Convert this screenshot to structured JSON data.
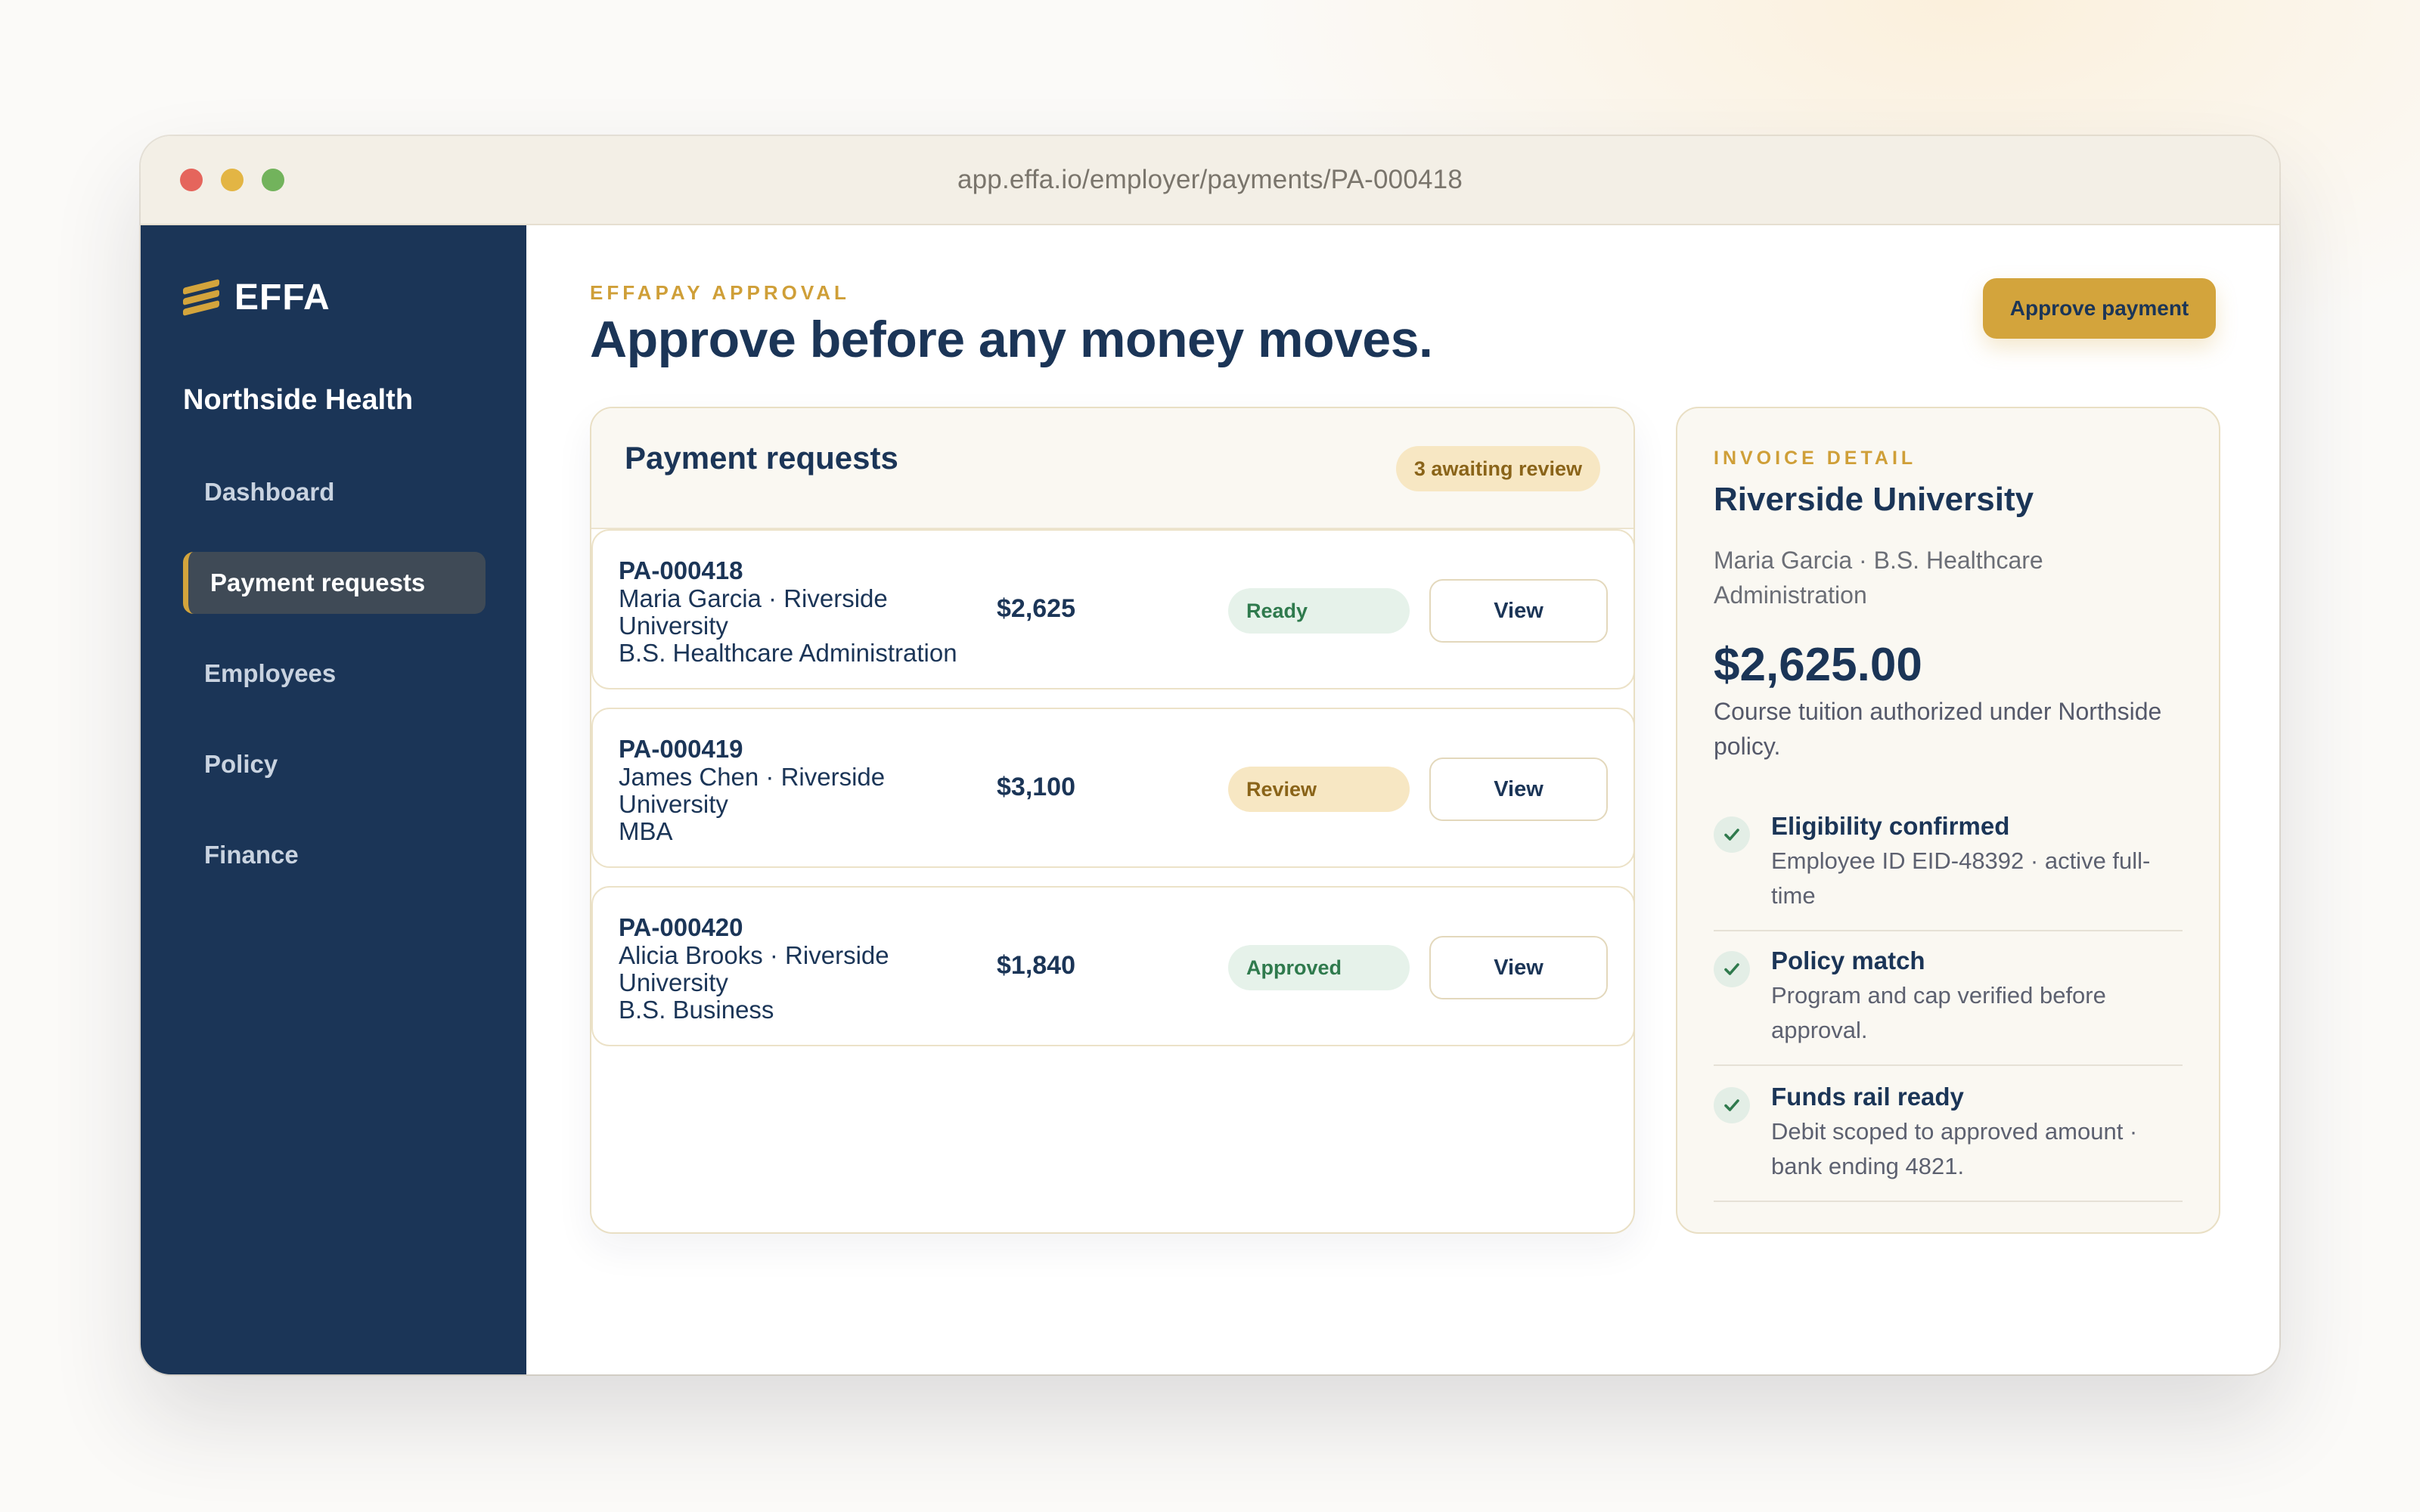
{
  "browser": {
    "url": "app.effa.io/employer/payments/PA-000418"
  },
  "sidebar": {
    "logo_text": "EFFA",
    "org_name": "Northside Health",
    "items": [
      {
        "label": "Dashboard",
        "active": false
      },
      {
        "label": "Payment requests",
        "active": true
      },
      {
        "label": "Employees",
        "active": false
      },
      {
        "label": "Policy",
        "active": false
      },
      {
        "label": "Finance",
        "active": false
      }
    ]
  },
  "header": {
    "eyebrow": "EFFAPAY APPROVAL",
    "title": "Approve before any money moves.",
    "approve_label": "Approve payment"
  },
  "requests": {
    "title": "Payment requests",
    "badge": "3 awaiting review",
    "rows": [
      {
        "id": "PA-000418",
        "line1": "Maria Garcia · Riverside",
        "line2": "University",
        "line3": "B.S. Healthcare Administration",
        "amount": "$2,625",
        "status": "Ready",
        "action": "View"
      },
      {
        "id": "PA-000419",
        "line1": "James Chen · Riverside",
        "line2": "University",
        "line3": "MBA",
        "amount": "$3,100",
        "status": "Review",
        "action": "View"
      },
      {
        "id": "PA-000420",
        "line1": "Alicia Brooks · Riverside",
        "line2": "University",
        "line3": "B.S. Business",
        "amount": "$1,840",
        "status": "Approved",
        "action": "View"
      }
    ]
  },
  "detail": {
    "eyebrow": "INVOICE DETAIL",
    "title": "Riverside University",
    "subtitle": "Maria Garcia · B.S. Healthcare Administration",
    "amount": "$2,625.00",
    "description": "Course tuition authorized under Northside policy.",
    "checks": [
      {
        "title": "Eligibility confirmed",
        "desc": "Employee ID EID-48392 · active full-time"
      },
      {
        "title": "Policy match",
        "desc": "Program and cap verified before approval."
      },
      {
        "title": "Funds rail ready",
        "desc": "Debit scoped to approved amount · bank ending 4821."
      }
    ]
  },
  "colors": {
    "navy": "#1b3557",
    "gold": "#d3a43c",
    "ready_bg": "#e6f2ea",
    "review_bg": "#f7e7c3"
  }
}
